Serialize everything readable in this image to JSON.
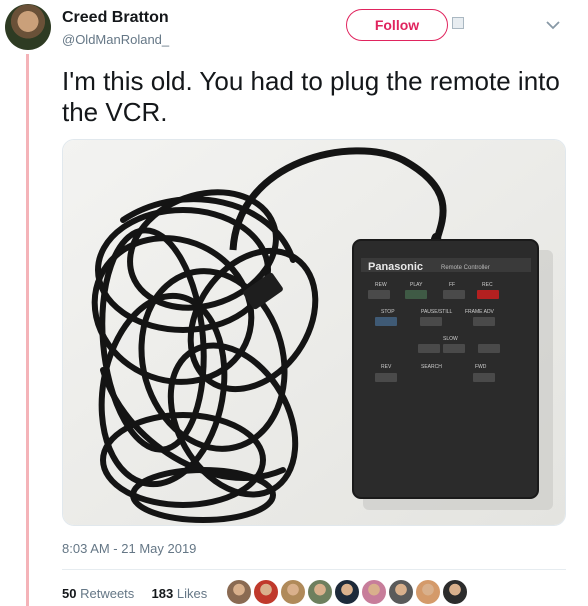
{
  "user": {
    "name": "Creed Bratton",
    "handle": "@OldManRoland_"
  },
  "header": {
    "follow_label": "Follow"
  },
  "tweet": {
    "text": "I'm this old. You had to plug the remote into the VCR.",
    "timestamp": "8:03 AM - 21 May 2019"
  },
  "remote": {
    "brand": "Panasonic",
    "subtitle": "Remote Controller",
    "buttons": {
      "rew": "REW",
      "play": "PLAY",
      "ff": "FF",
      "rec": "REC",
      "stop": "STOP",
      "pause_still": "PAUSE/STILL",
      "frame_adv": "FRAME ADV",
      "slow": "SLOW",
      "rev": "REV",
      "search": "SEARCH",
      "fwd": "FWD"
    }
  },
  "stats": {
    "retweets_count": "50",
    "retweets_label": "Retweets",
    "likes_count": "183",
    "likes_label": "Likes"
  },
  "likers": [
    {
      "color": "#8a6a52"
    },
    {
      "color": "#c0392b"
    },
    {
      "color": "#b08a5a"
    },
    {
      "color": "#6e7f5e"
    },
    {
      "color": "#1d2a3a"
    },
    {
      "color": "#c77d9a"
    },
    {
      "color": "#5a5a5a"
    },
    {
      "color": "#d49a6a"
    },
    {
      "color": "#2c2c2c"
    }
  ],
  "colors": {
    "accent": "#e0245e",
    "thread_line": "#f4b3b8"
  }
}
